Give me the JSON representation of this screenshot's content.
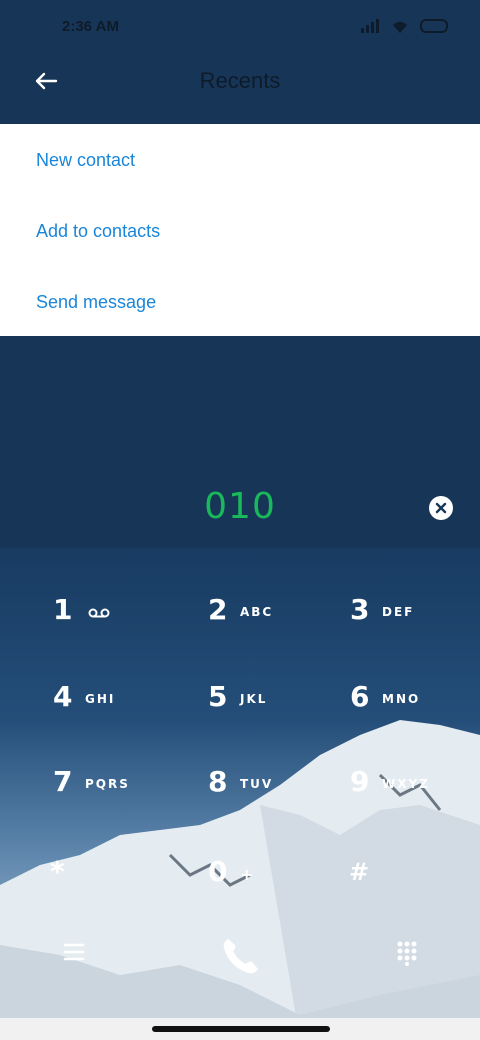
{
  "status": {
    "time": "2:36 AM"
  },
  "header": {
    "title": "Recents"
  },
  "menu": [
    "New contact",
    "Add to contacts",
    "Send message"
  ],
  "dialer": {
    "number": "010"
  },
  "keys": [
    {
      "digit": "1",
      "letters": ""
    },
    {
      "digit": "2",
      "letters": "ABC"
    },
    {
      "digit": "3",
      "letters": "DEF"
    },
    {
      "digit": "4",
      "letters": "GHI"
    },
    {
      "digit": "5",
      "letters": "JKL"
    },
    {
      "digit": "6",
      "letters": "MNO"
    },
    {
      "digit": "7",
      "letters": "PQRS"
    },
    {
      "digit": "8",
      "letters": "TUV"
    },
    {
      "digit": "9",
      "letters": "WXYZ"
    },
    {
      "digit": "*",
      "letters": ""
    },
    {
      "digit": "0",
      "letters": "+"
    },
    {
      "digit": "#",
      "letters": ""
    }
  ],
  "colors": {
    "accent": "#1a86d9",
    "number": "#19b85a",
    "header_bg": "#173657"
  }
}
